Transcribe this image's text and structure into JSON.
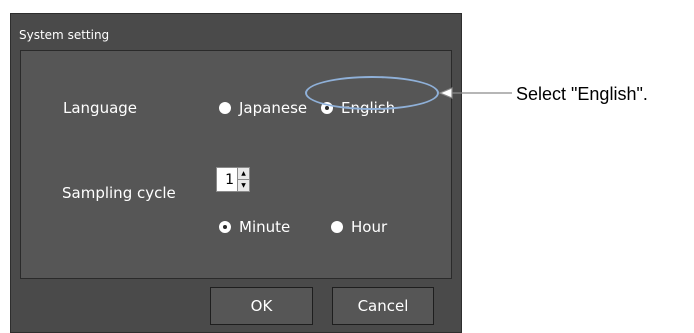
{
  "dialog": {
    "title": "System setting",
    "language": {
      "label": "Language",
      "options": [
        "Japanese",
        "English"
      ],
      "selected": "English"
    },
    "sampling": {
      "label": "Sampling cycle",
      "value": "1",
      "units": [
        "Minute",
        "Hour"
      ],
      "selected_unit": "Minute"
    },
    "ok_label": "OK",
    "cancel_label": "Cancel"
  },
  "annotation": {
    "text": "Select \"English\".",
    "highlight_color": "#8fb0d8"
  }
}
